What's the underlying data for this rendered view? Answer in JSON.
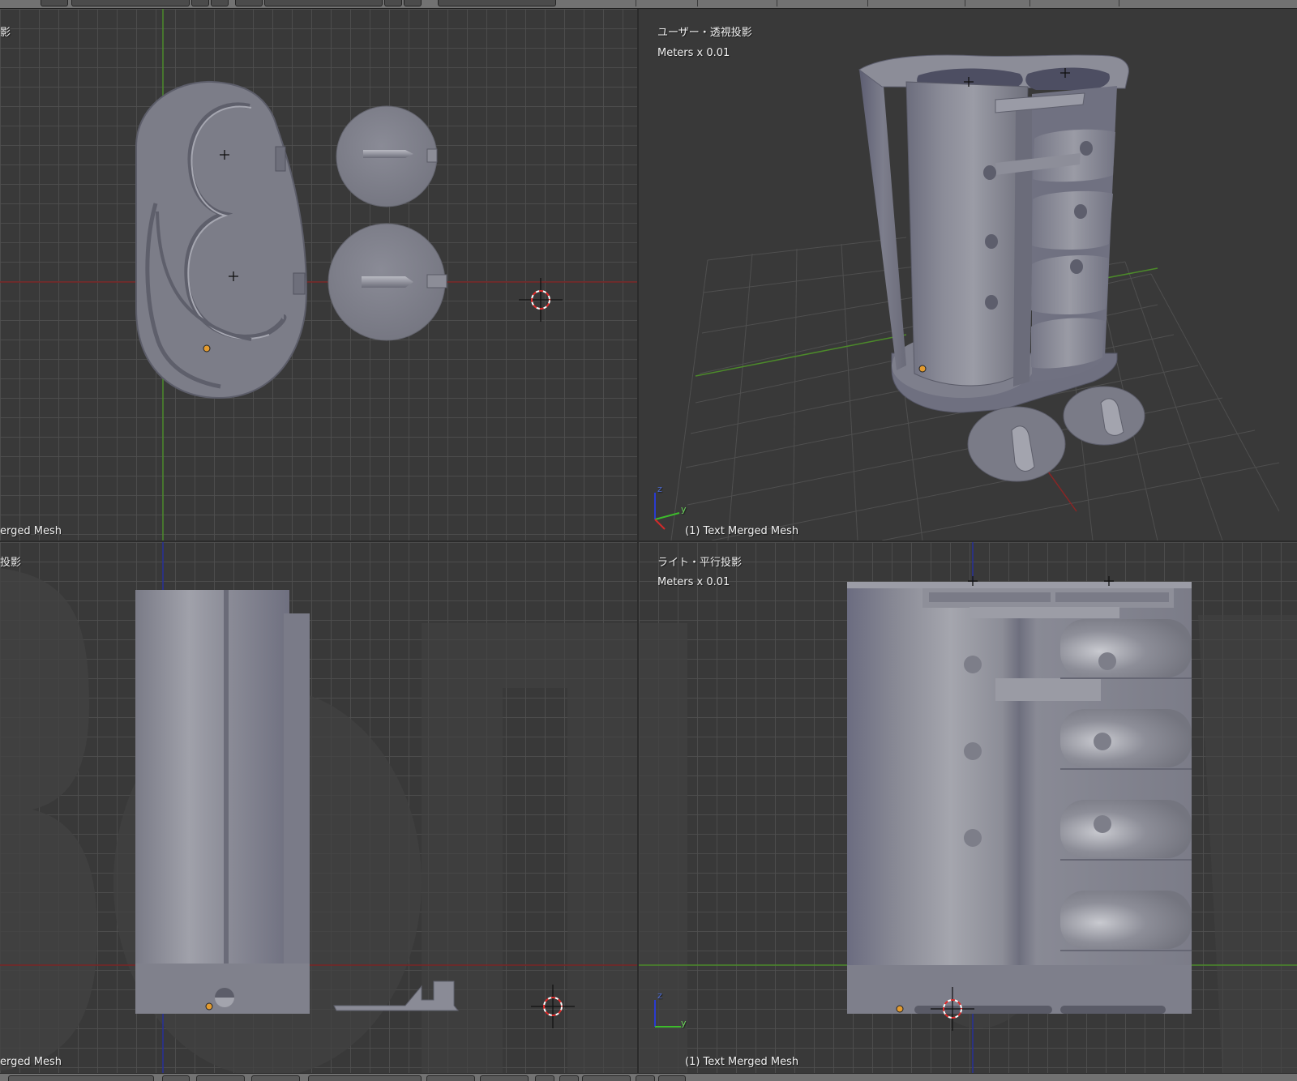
{
  "colors": {
    "background": "#393939",
    "grid": "#505050",
    "axis_x": "#7a2525",
    "axis_y": "#4c8a2a",
    "axis_z": "#27309a",
    "mesh": "#7a7b87",
    "mesh_light": "#9fa0aa",
    "mesh_dark": "#55566a",
    "origin_dot": "#e39b2f",
    "header": "#727272",
    "label_text": "#f0f0f0"
  },
  "viewports": {
    "top_left": {
      "view_name": "影",
      "mesh_name": "erged Mesh"
    },
    "top_right": {
      "view_name": "ユーザー・透視投影",
      "units": "Meters x 0.01",
      "mesh_name": "(1) Text Merged Mesh",
      "axis_labels": {
        "z": "z",
        "y": "y"
      }
    },
    "bottom_left": {
      "view_name": "投影",
      "mesh_name": "erged Mesh"
    },
    "bottom_right": {
      "view_name": "ライト・平行投影",
      "units": "Meters x 0.01",
      "mesh_name": "(1) Text Merged Mesh",
      "axis_labels": {
        "z": "z",
        "y": "y"
      }
    }
  }
}
